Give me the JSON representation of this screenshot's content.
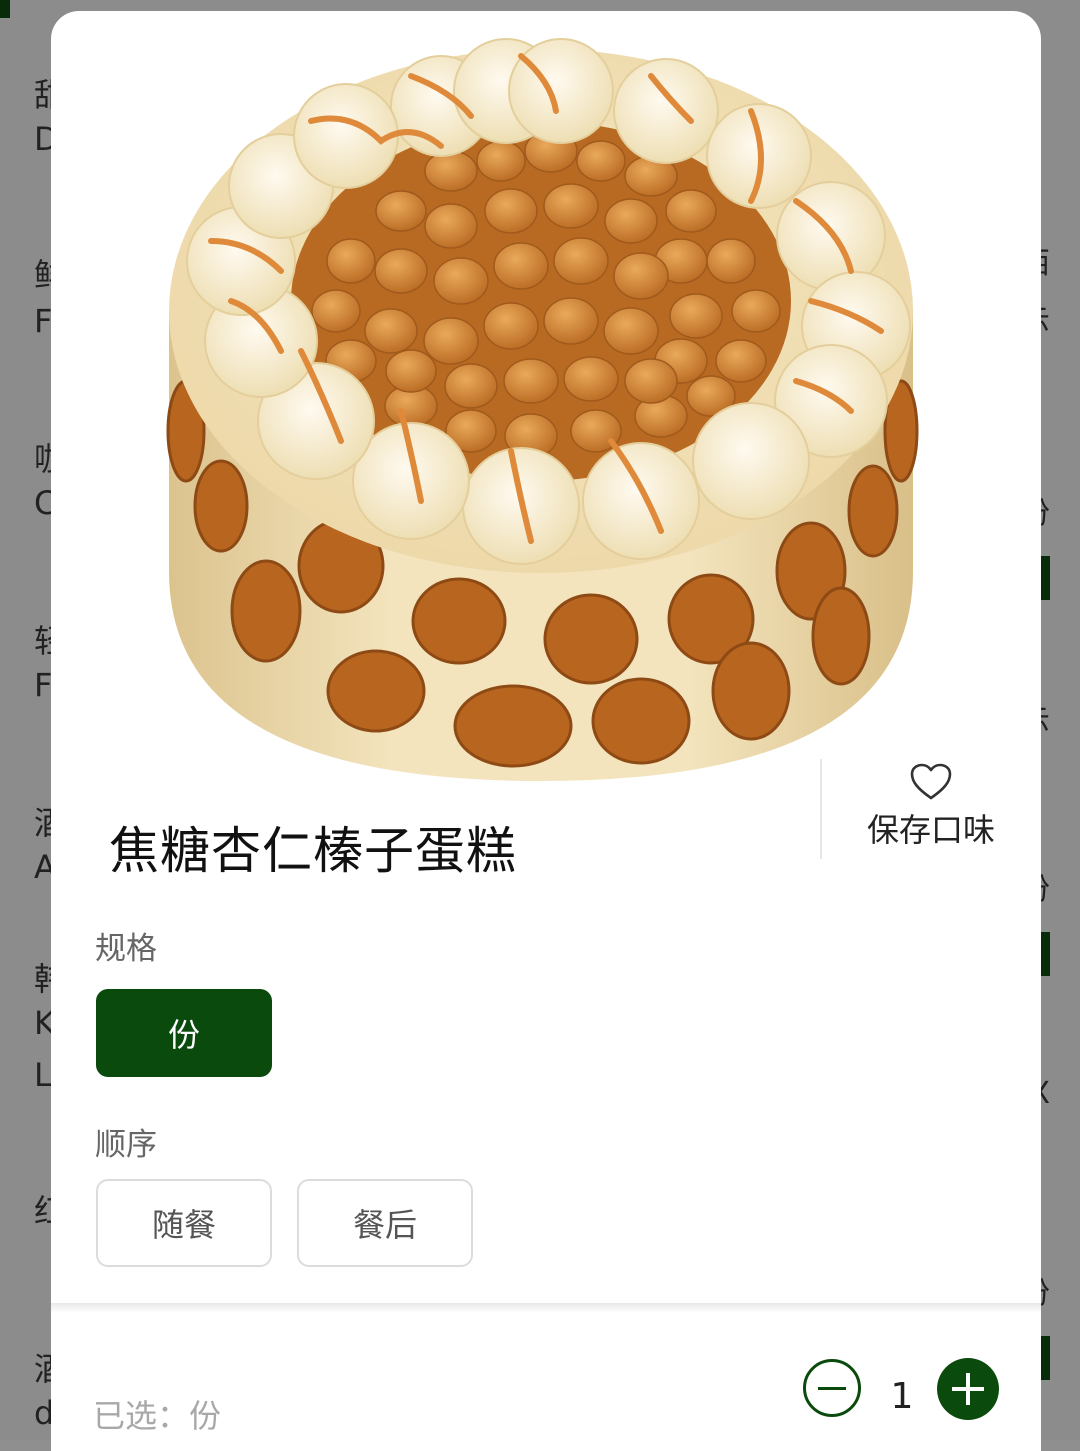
{
  "background_page": {
    "left_initials": [
      "甜",
      "D",
      "鲜",
      "F",
      "咖",
      "C",
      "轻",
      "F",
      "酒",
      "A",
      "韩",
      "K",
      "L",
      "红",
      "酒",
      "d"
    ],
    "right_fragments": [
      "西",
      "示",
      "份",
      "示",
      "份",
      "示",
      "份",
      "X",
      "份"
    ]
  },
  "product": {
    "title": "焦糖杏仁榛子蛋糕",
    "image_desc": "cake-image"
  },
  "favorite": {
    "label": "保存口味",
    "icon": "heart-icon"
  },
  "spec": {
    "label": "规格",
    "options": [
      {
        "label": "份",
        "selected": true
      }
    ]
  },
  "order": {
    "label": "顺序",
    "options": [
      {
        "label": "随餐",
        "selected": false
      },
      {
        "label": "餐后",
        "selected": false
      }
    ]
  },
  "footer": {
    "selected_text": "已选：份",
    "quantity": "1"
  },
  "colors": {
    "accent": "#0b4a0d"
  }
}
